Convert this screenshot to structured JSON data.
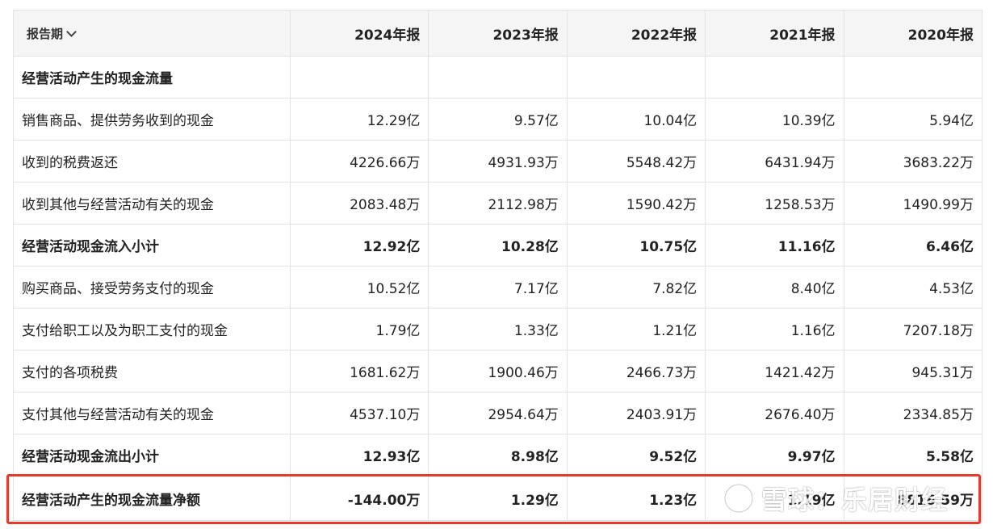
{
  "header": {
    "period_label": "报告期",
    "years": [
      "2024年报",
      "2023年报",
      "2022年报",
      "2021年报",
      "2020年报"
    ]
  },
  "rows": [
    {
      "label": "经营活动产生的现金流量",
      "bold": true,
      "values": [
        "",
        "",
        "",
        "",
        ""
      ]
    },
    {
      "label": "销售商品、提供劳务收到的现金",
      "bold": false,
      "values": [
        "12.29亿",
        "9.57亿",
        "10.04亿",
        "10.39亿",
        "5.94亿"
      ]
    },
    {
      "label": "收到的税费返还",
      "bold": false,
      "values": [
        "4226.66万",
        "4931.93万",
        "5548.42万",
        "6431.94万",
        "3683.22万"
      ]
    },
    {
      "label": "收到其他与经营活动有关的现金",
      "bold": false,
      "values": [
        "2083.48万",
        "2112.98万",
        "1590.42万",
        "1258.53万",
        "1490.99万"
      ]
    },
    {
      "label": "经营活动现金流入小计",
      "bold": true,
      "values": [
        "12.92亿",
        "10.28亿",
        "10.75亿",
        "11.16亿",
        "6.46亿"
      ]
    },
    {
      "label": "购买商品、接受劳务支付的现金",
      "bold": false,
      "values": [
        "10.52亿",
        "7.17亿",
        "7.82亿",
        "8.40亿",
        "4.53亿"
      ]
    },
    {
      "label": "支付给职工以及为职工支付的现金",
      "bold": false,
      "values": [
        "1.79亿",
        "1.33亿",
        "1.21亿",
        "1.16亿",
        "7207.18万"
      ]
    },
    {
      "label": "支付的各项税费",
      "bold": false,
      "values": [
        "1681.62万",
        "1900.46万",
        "2466.73万",
        "1421.42万",
        "945.31万"
      ]
    },
    {
      "label": "支付其他与经营活动有关的现金",
      "bold": false,
      "values": [
        "4537.10万",
        "2954.64万",
        "2403.91万",
        "2676.40万",
        "2334.85万"
      ]
    },
    {
      "label": "经营活动现金流出小计",
      "bold": true,
      "values": [
        "12.93亿",
        "8.98亿",
        "9.52亿",
        "9.97亿",
        "5.58亿"
      ]
    },
    {
      "label": "经营活动产生的现金流量净额",
      "bold": true,
      "values": [
        "-144.00万",
        "1.29亿",
        "1.23亿",
        "1.19亿",
        "8816.59万"
      ]
    }
  ],
  "watermark": {
    "text": "雪球：乐居财经",
    "icon": "snowball-logo-icon"
  },
  "colors": {
    "highlight": "#e8392f",
    "header_bg": "#f5f5f5",
    "border": "#e3e3e3"
  }
}
